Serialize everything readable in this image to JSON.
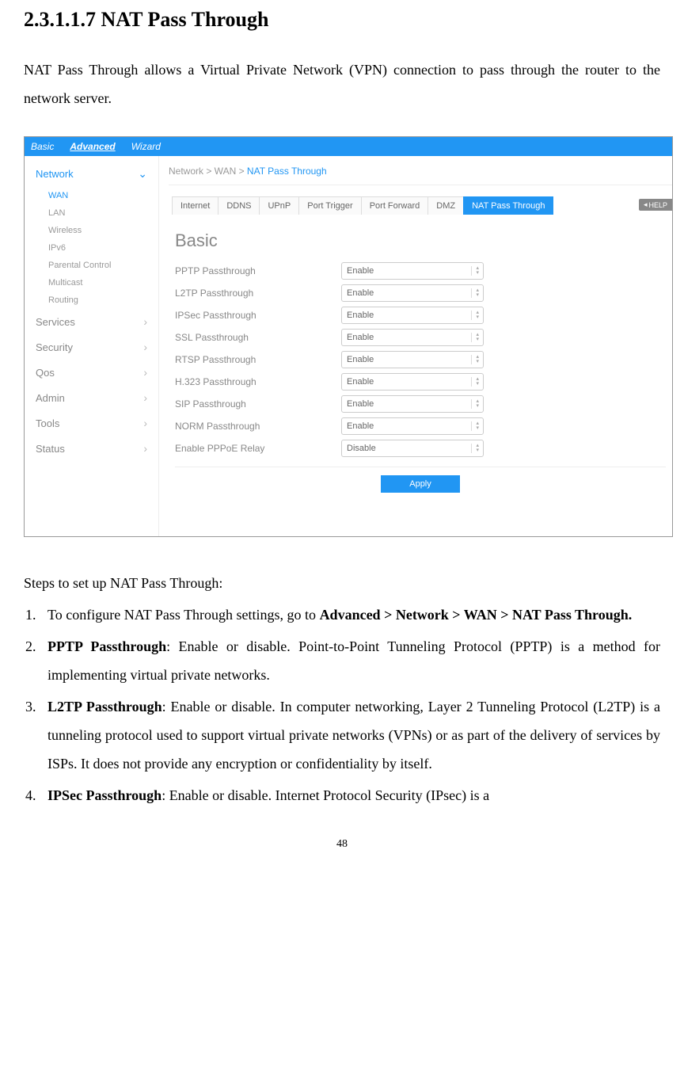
{
  "heading": "2.3.1.1.7 NAT Pass Through",
  "intro": "NAT Pass Through allows a Virtual Private Network (VPN) connection to pass through the router to the network server.",
  "topnav": {
    "basic": "Basic",
    "advanced": "Advanced",
    "wizard": "Wizard"
  },
  "sidebar": {
    "network": "Network",
    "network_sub": [
      "WAN",
      "LAN",
      "Wireless",
      "IPv6",
      "Parental Control",
      "Multicast",
      "Routing"
    ],
    "sections": [
      "Services",
      "Security",
      "Qos",
      "Admin",
      "Tools",
      "Status"
    ]
  },
  "breadcrumb": {
    "p1": "Network > WAN > ",
    "p2": "NAT Pass Through"
  },
  "tabs": [
    "Internet",
    "DDNS",
    "UPnP",
    "Port Trigger",
    "Port Forward",
    "DMZ",
    "NAT Pass Through"
  ],
  "help": "HELP",
  "section_title": "Basic",
  "form": [
    {
      "label": "PPTP Passthrough",
      "value": "Enable"
    },
    {
      "label": "L2TP Passthrough",
      "value": "Enable"
    },
    {
      "label": "IPSec Passthrough",
      "value": "Enable"
    },
    {
      "label": "SSL Passthrough",
      "value": "Enable"
    },
    {
      "label": "RTSP Passthrough",
      "value": "Enable"
    },
    {
      "label": "H.323 Passthrough",
      "value": "Enable"
    },
    {
      "label": "SIP Passthrough",
      "value": "Enable"
    },
    {
      "label": "NORM Passthrough",
      "value": "Enable"
    },
    {
      "label": "Enable PPPoE Relay",
      "value": "Disable"
    }
  ],
  "apply": "Apply",
  "steps_intro": "Steps to set up NAT Pass Through:",
  "steps": {
    "s1_a": "To configure NAT Pass Through settings, go to ",
    "s1_b": "Advanced > Network > WAN > NAT Pass Through.",
    "s2_a": "PPTP Passthrough",
    "s2_b": ": Enable or disable. Point-to-Point Tunneling Protocol (PPTP) is a method for implementing virtual private networks.",
    "s3_a": "L2TP Passthrough",
    "s3_b": ": Enable or disable. In computer networking, Layer 2 Tunneling Protocol (L2TP) is a tunneling protocol used to support virtual private networks (VPNs) or as part of the delivery of services by ISPs. It does not provide any encryption or confidentiality by itself.",
    "s4_a": "IPSec Passthrough",
    "s4_b": ": Enable or disable. Internet Protocol Security (IPsec) is a"
  },
  "page_number": "48"
}
